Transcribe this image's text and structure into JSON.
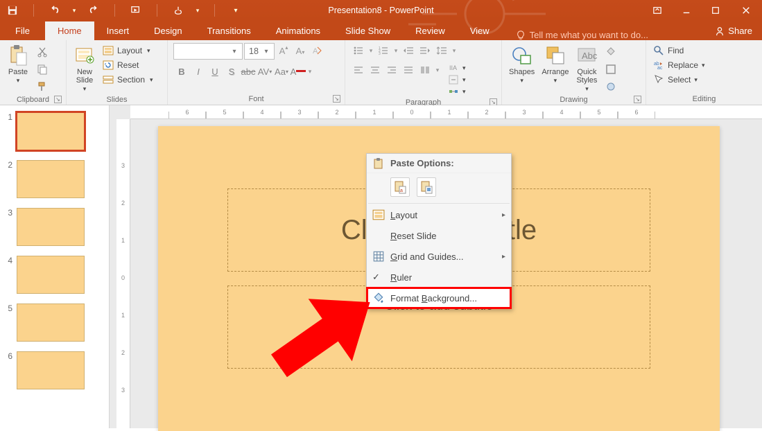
{
  "titlebar": {
    "title": "Presentation8 - PowerPoint"
  },
  "ribbon_tabs": {
    "file": "File",
    "home": "Home",
    "insert": "Insert",
    "design": "Design",
    "transitions": "Transitions",
    "animations": "Animations",
    "slideshow": "Slide Show",
    "review": "Review",
    "view": "View",
    "tellme": "Tell me what you want to do...",
    "share": "Share"
  },
  "groups": {
    "clipboard": {
      "label": "Clipboard",
      "paste": "Paste"
    },
    "slides": {
      "label": "Slides",
      "newslide": "New\nSlide",
      "layout": "Layout",
      "reset": "Reset",
      "section": "Section"
    },
    "font": {
      "label": "Font",
      "name_ph": "",
      "size": "18"
    },
    "paragraph": {
      "label": "Paragraph"
    },
    "drawing": {
      "label": "Drawing",
      "shapes": "Shapes",
      "arrange": "Arrange",
      "quick": "Quick\nStyles"
    },
    "editing": {
      "label": "Editing",
      "find": "Find",
      "replace": "Replace",
      "select": "Select"
    }
  },
  "ruler": {
    "h": [
      "6",
      "5",
      "4",
      "3",
      "2",
      "1",
      "0",
      "1",
      "2",
      "3",
      "4",
      "5",
      "6"
    ],
    "v": [
      "3",
      "2",
      "1",
      "0",
      "1",
      "2",
      "3"
    ]
  },
  "thumbs": [
    {
      "n": "1"
    },
    {
      "n": "2"
    },
    {
      "n": "3"
    },
    {
      "n": "4"
    },
    {
      "n": "5"
    },
    {
      "n": "6"
    }
  ],
  "slide": {
    "title_ph": "Click to add title",
    "sub_ph": "Click to add subtitle"
  },
  "ctx": {
    "header": "Paste Options:",
    "layout": "Layout",
    "reset": "Reset Slide",
    "grid": "Grid and Guides...",
    "ruler": "Ruler",
    "fmtbg": "Format Background..."
  }
}
